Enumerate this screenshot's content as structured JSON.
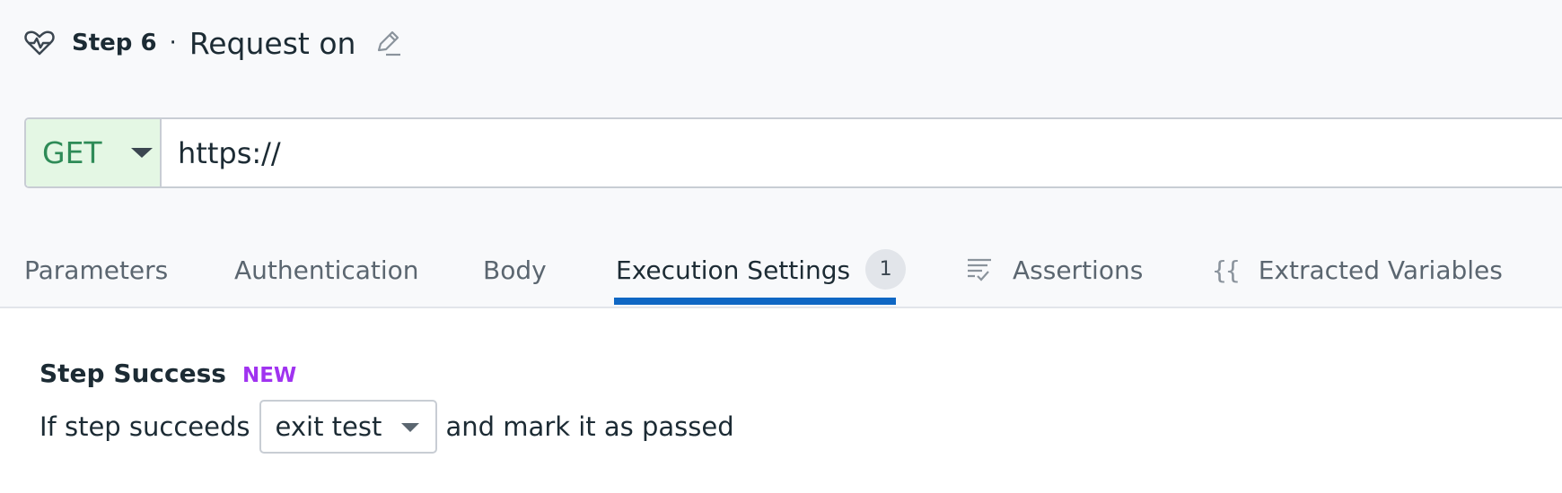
{
  "step": {
    "icon": "heartbeat-icon",
    "number_label": "Step 6",
    "separator": "·",
    "name": "Request on",
    "edit_icon": "pencil-icon"
  },
  "request": {
    "method": "GET",
    "url": "https://",
    "method_color": "#2e8b57",
    "method_bg": "#e4f7e4"
  },
  "tabs": [
    {
      "label": "Parameters"
    },
    {
      "label": "Authentication"
    },
    {
      "label": "Body"
    },
    {
      "label": "Execution Settings",
      "badge": "1",
      "active": true
    },
    {
      "label": "Assertions",
      "icon": "assertions-list-icon"
    },
    {
      "label": "Extracted Variables",
      "icon": "braces-icon",
      "icon_text": "{{"
    }
  ],
  "accent_color": "#0f67c4",
  "step_success": {
    "title": "Step Success",
    "badge": "NEW",
    "badge_color": "#a033f0",
    "prefix": "If step succeeds",
    "action": "exit test",
    "suffix": "and mark it as passed"
  }
}
